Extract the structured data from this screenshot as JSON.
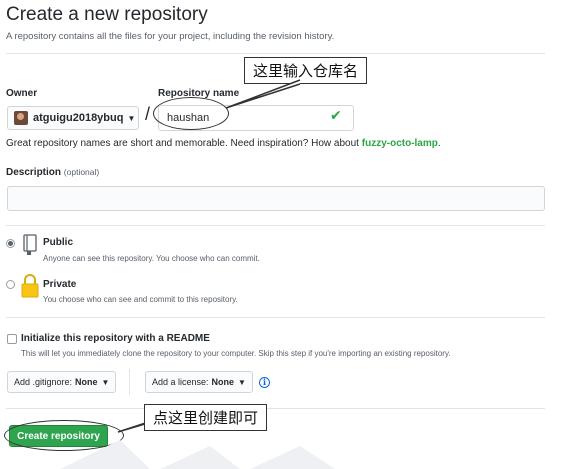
{
  "page": {
    "title": "Create a new repository",
    "subtitle": "A repository contains all the files for your project, including the revision history."
  },
  "owner": {
    "label": "Owner",
    "value": "atguigu2018ybuq",
    "separator": "/"
  },
  "repo_name": {
    "label": "Repository name",
    "value": "haushan",
    "valid_icon": "check-icon",
    "hint_text": "Great repository names are short and memorable. Need inspiration? How about ",
    "suggestion": "fuzzy-octo-lamp",
    "hint_end": "."
  },
  "description": {
    "label": "Description",
    "optional": "(optional)",
    "value": ""
  },
  "visibility": {
    "public": {
      "title": "Public",
      "desc": "Anyone can see this repository. You choose who can commit.",
      "selected": true,
      "icon": "repo-icon"
    },
    "private": {
      "title": "Private",
      "desc": "You choose who can see and commit to this repository.",
      "selected": false,
      "icon": "lock-icon"
    }
  },
  "readme": {
    "title": "Initialize this repository with a README",
    "desc": "This will let you immediately clone the repository to your computer. Skip this step if you're importing an existing repository.",
    "checked": false
  },
  "gitignore": {
    "label": "Add .gitignore:",
    "value": "None"
  },
  "license": {
    "label": "Add a license:",
    "value": "None"
  },
  "create_button": "Create repository",
  "annotations": {
    "repo_name_callout": "这里输入仓库名",
    "create_callout": "点这里创建即可"
  },
  "colors": {
    "accent_green": "#2ea44f",
    "link_blue": "#0366d6",
    "suggestion_green": "#28a745"
  }
}
